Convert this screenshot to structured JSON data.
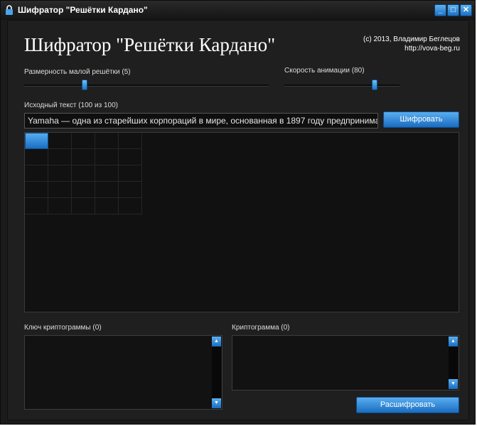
{
  "window": {
    "title": "Шифратор \"Решётки Кардано\""
  },
  "header": {
    "heading": "Шифратор \"Решётки Кардано\"",
    "copyright_line1": "(c) 2013, Владимир Беглецов",
    "copyright_line2": "http://vova-beg.ru"
  },
  "grid_size": {
    "label": "Размерность малой решётки (5)",
    "value": 5,
    "fraction": 0.24
  },
  "animation_speed": {
    "label": "Скорость анимации (80)",
    "value": 80,
    "fraction": 0.8
  },
  "source": {
    "label": "Исходный текст (100 из 100)",
    "value": "Yamaha — одна из старейших корпораций в мире, основанная в 1897 году предпринимате"
  },
  "buttons": {
    "encrypt": "Шифровать",
    "decrypt": "Расшифровать"
  },
  "key": {
    "label": "Ключ криптограммы (0)",
    "value": ""
  },
  "cryptogram": {
    "label": "Криптограмма (0)",
    "value": ""
  },
  "colors": {
    "accent": "#1f74c7",
    "background": "#1f1f1f"
  },
  "icons": {
    "app": "lock-icon",
    "minimize": "minimize-icon",
    "maximize": "maximize-icon",
    "close": "close-icon",
    "scroll_up": "scroll-up-icon",
    "scroll_down": "scroll-down-icon"
  }
}
